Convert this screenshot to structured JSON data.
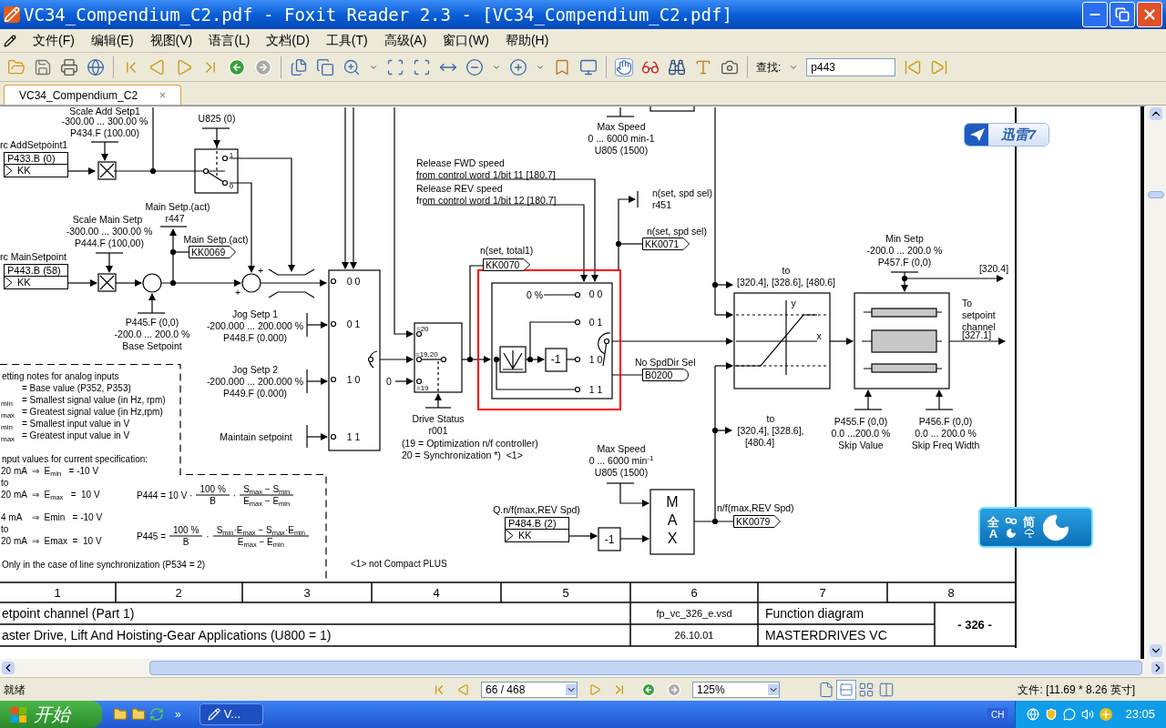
{
  "window": {
    "title": "VC34_Compendium_C2.pdf - Foxit Reader 2.3 - [VC34_Compendium_C2.pdf]"
  },
  "menu": [
    "文件(F)",
    "编辑(E)",
    "视图(V)",
    "语言(L)",
    "文档(D)",
    "工具(T)",
    "高级(A)",
    "窗口(W)",
    "帮助(H)"
  ],
  "toolbar": {
    "hand_tool": {
      "selected": true
    },
    "search": {
      "label": "查找:",
      "value": "p443"
    }
  },
  "tabs": [
    {
      "label": "VC34_Compendium_C2",
      "close": "×",
      "selected": true
    }
  ],
  "diagram": {
    "labels": [
      "Scale Add Setp1",
      "-300.00 ... 300.00 %",
      "P434.F (100.00)",
      "U825 (0)",
      "rc AddSetpoint1",
      "Main Setp.(act)",
      "r447",
      "Scale Main Setp",
      "-300.00 ... 300.00 %",
      "P444.F (100,00)",
      "Main Setp.(act)",
      "rc MainSetpoint",
      "P445.F (0,0)",
      "-200.0 ... 200.0 %",
      "Base Setpoint",
      "Jog Setp 1",
      "-200.000 ... 200.000 %",
      "P448.F (0.000)",
      "Jog Setp 2",
      "-200.000 ... 200.000 %",
      "P449.F (0.000)",
      "Maintain setpoint",
      "0 0",
      "0 1",
      "1 0",
      "1 1",
      "etting notes for analog inputs",
      "= Base value (P352, P353)",
      "= Smallest signal value (in Hz, rpm)",
      "= Greatest signal value (in Hz,rpm)",
      "= Smallest input value in V",
      "= Greatest input value in V",
      "min",
      "max",
      "min",
      "max",
      "nput values for current specification:",
      "20 mA  ⇒  E$_{min}$   = -10 V",
      "to",
      "20 mA  ⇒  E$_{max}$   =  10 V",
      "4 mA    ⇒  Emin   = -10 V",
      "to",
      "20 mA  ⇒  Emax  =  10 V",
      "Only in the case of line synchronization (P534 = 2)",
      "<1> not Compact PLUS",
      "Max Speed",
      "0 ... 6000 min-1",
      "U805 (1500)",
      "Release FWD speed",
      "from control word 1/bit 11 [180.7]",
      "Release REV speed",
      "from control word 1/bit 12 [180.7]",
      "n(set, spd sel)",
      "r451",
      "n(set, spd sel)",
      "n(set, total1)",
      "=20",
      "=19,20",
      "=19",
      "0",
      "0 %",
      "0 0",
      "0 1",
      "1 0",
      "1 1",
      "-1",
      "No SpdDir Sel",
      "Drive Status",
      "r001",
      "(19 = Optimization n/f controller)",
      "20 = Synchronization *)  <1>",
      "Max Speed",
      "0 ... 6000 min$^{-1}$",
      "U805 (1500)",
      "M",
      "A",
      "X",
      "Q.n/f(max,REV Spd)",
      "-1",
      "to",
      "[320.4], [328.6], [480.6]",
      "y",
      "x",
      "Min Setp",
      "-200.0 ... 200.0 %",
      "P457.F (0,0)",
      "[320.4]",
      "To",
      "setpoint",
      "channel",
      "[327.1]",
      "to",
      "[320.4], [328.6],",
      "[480.4]",
      "n/f(max,REV Spd)",
      "P455.F (0,0)",
      "0.0 ...200.0 %",
      "Skip Value",
      "P456.F (0,0)",
      "0.0 ... 200.0 %",
      "Skip Freq Width",
      "1",
      "0",
      "+",
      "+"
    ],
    "sources": [
      {
        "parameter": "P433.B (0)",
        "connector": "KK"
      },
      {
        "parameter": "P443.B (58)",
        "connector": "KK"
      },
      {
        "parameter": "P484.B (2)",
        "connector": "KK"
      }
    ],
    "connectors": [
      {
        "label": "KK0069",
        "kind": "output"
      },
      {
        "label": "KK0071",
        "kind": "output"
      },
      {
        "label": "KK0070",
        "kind": "output"
      },
      {
        "label": "KK0079",
        "kind": "output"
      },
      {
        "label": "B0200",
        "kind": "binary"
      }
    ],
    "formulas": [
      {
        "lhs": "P444 = 10 V ·",
        "fractions": [
          {
            "num": "100 %",
            "den": "B"
          },
          {
            "num": "S$_{max}$ − S$_{min}$",
            "den": "E$_{max}$ − E$_{min}$"
          }
        ],
        "separator": "·"
      },
      {
        "lhs": "P445 =",
        "fractions": [
          {
            "num": "100 %",
            "den": "B"
          },
          {
            "num": "S$_{min}$·E$_{max}$ − S$_{max}$·E$_{min}$",
            "den": "E$_{max}$ − E$_{min}$"
          }
        ],
        "separator": "·"
      }
    ]
  },
  "title_block": {
    "columns": [
      "1",
      "2",
      "3",
      "4",
      "5",
      "6",
      "7",
      "8"
    ],
    "title": "etpoint channel (Part 1)",
    "subtitle": "aster Drive, Lift And Hoisting-Gear Applications (U800 = 1)",
    "file": "fp_vc_326_e.vsd",
    "date": "26.10.01",
    "type": "Function diagram",
    "product": "MASTERDRIVES VC",
    "page": "- 326 -"
  },
  "overlays": {
    "download_badge": "迅雷7",
    "ime_bar": [
      "全",
      "A",
      "简"
    ]
  },
  "status_bar": {
    "text": "就绪",
    "page": "66 / 468",
    "zoom": "125%",
    "view_modes": [
      {
        "selected": false
      },
      {
        "selected": true
      },
      {
        "selected": false
      },
      {
        "selected": false
      }
    ],
    "file_size": "文件: [11.69 * 8.26 英寸]"
  },
  "taskbar": {
    "start": "开始",
    "more": "»",
    "tasks": [
      "V..."
    ],
    "input_language": "CH",
    "clock": "23:05"
  }
}
